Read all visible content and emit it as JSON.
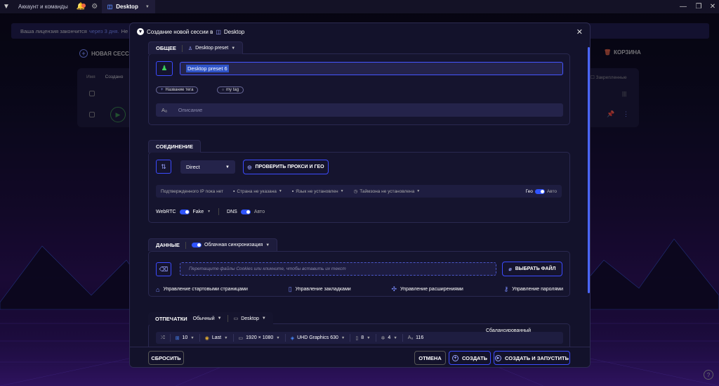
{
  "titlebar": {
    "tab_account": "Аккаунт и команды",
    "tab_desktop": "Desktop"
  },
  "background": {
    "license_text": "Ваша лицензия закончится",
    "license_highlight": "через 3 дня.",
    "license_tail": "Не",
    "new_session": "НОВАЯ СЕССИЯ",
    "trash": "КОРЗИНА",
    "col_name": "Имя",
    "col_created": "Создано",
    "col_pinned": "Закрепленные"
  },
  "modal": {
    "title": "Создание новой сессии в",
    "workspace": "Desktop",
    "general": {
      "title": "ОБЩЕЕ",
      "preset": "Desktop preset",
      "name_value": "Desktop preset 6",
      "tag_button": "Название тега",
      "tag": "my tag",
      "description_placeholder": "Описание"
    },
    "connection": {
      "title": "СОЕДИНЕНИЕ",
      "proxy_type": "Direct",
      "check_button": "ПРОВЕРИТЬ ПРОКСИ И ГЕО",
      "ip_status": "Подтвержденного IP пока нет",
      "country": "Страна не указана",
      "language": "Язык не установлен",
      "timezone": "Таймзона не установлена",
      "geo_label": "Гео",
      "geo_value": "Авто",
      "webrtc_label": "WebRTC",
      "webrtc_value": "Fake",
      "dns_label": "DNS",
      "dns_value": "Авто"
    },
    "data": {
      "title": "ДАННЫЕ",
      "sync": "Облачная синхронизация",
      "drop_placeholder": "Перетащите файлы Cookies или кликните, чтобы вставить их текст",
      "choose_file": "ВЫБРАТЬ ФАЙЛ",
      "links": [
        "Управление стартовыми страницами",
        "Управление закладками",
        "Управление расширениями",
        "Управление паролями"
      ]
    },
    "fingerprints": {
      "title": "ОТПЕЧАТКИ",
      "mode": "Обычный",
      "platform": "Desktop",
      "balanced": "Сбалансированный",
      "os": "10",
      "browser": "Last",
      "resolution": "1920 × 1080",
      "gpu": "UHD Graphics 630",
      "memory": "8",
      "cpu": "4",
      "fonts": "116"
    },
    "footer": {
      "reset": "СБРОСИТЬ",
      "cancel": "ОТМЕНА",
      "create": "СОЗДАТЬ",
      "create_run": "СОЗДАТЬ И ЗАПУСТИТЬ"
    }
  },
  "colors": {
    "accent": "#3c4bff",
    "toggle_on": "#2f54ff",
    "balanced_underline": "#ff7a1a",
    "play_green": "#3a8f4a"
  }
}
